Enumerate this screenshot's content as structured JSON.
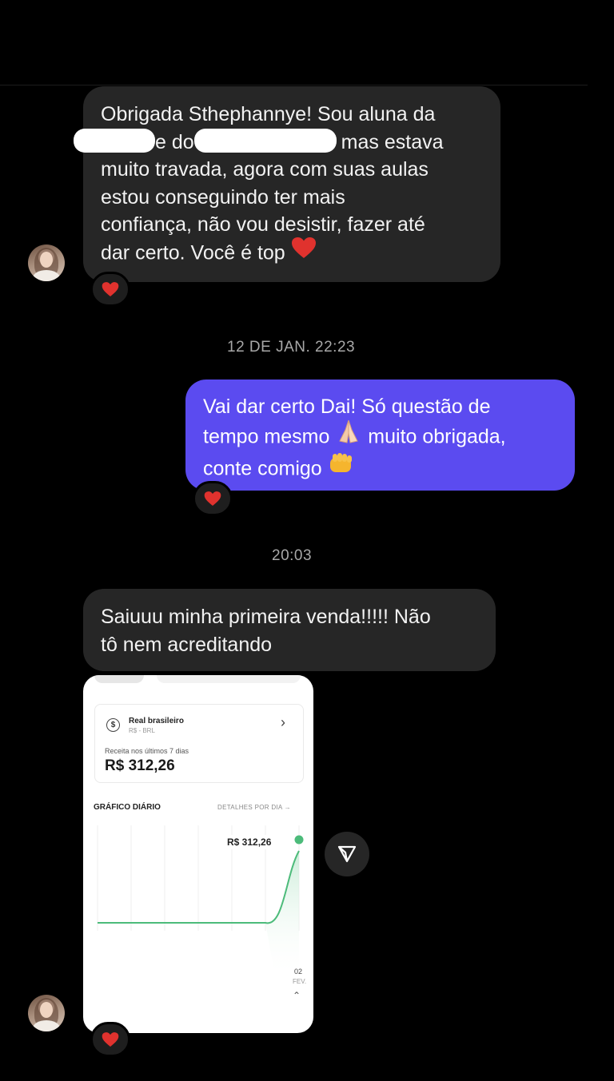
{
  "messages": {
    "msg1": {
      "line1": "Obrigada Sthephannye! Sou aluna da",
      "line2_mid": "e do",
      "line2_end": "mas estava",
      "line3": "muito travada, agora com suas aulas",
      "line4": "estou conseguindo ter mais",
      "line5": "confiança, não vou desistir, fazer até",
      "line6": "dar certo. Você é top"
    },
    "timestamp1": "12 DE JAN. 22:23",
    "msg2": {
      "line1": "Vai dar certo Dai! Só questão de",
      "line2a": "tempo mesmo",
      "line2b": "muito obrigada,",
      "line3": "conte comigo"
    },
    "timestamp2": "20:03",
    "msg3": {
      "line1": "Saiuuu minha primeira venda!!!!! Não",
      "line2": "tô nem acreditando"
    }
  },
  "screenshot_card": {
    "currency_symbol": "$",
    "currency_name": "Real brasileiro",
    "currency_code": "R$ - BRL",
    "revenue_label": "Receita nos últimos 7 dias",
    "revenue_value": "R$ 312,26",
    "chart_title": "GRÁFICO DIÁRIO",
    "details_link": "DETALHES POR DIA →",
    "point_label": "R$ 312,26",
    "x_day": "02",
    "x_month": "FEV."
  },
  "chart_data": {
    "type": "area",
    "title": "GRÁFICO DIÁRIO",
    "x": [
      "",
      "",
      "",
      "",
      "",
      "",
      "02 FEV."
    ],
    "series": [
      {
        "values": [
          0,
          0,
          0,
          0,
          0,
          0,
          312.26
        ]
      }
    ],
    "annotations": [
      "R$ 312,26"
    ],
    "grid": true,
    "color": "#4cbb7a"
  },
  "colors": {
    "incoming_bubble": "#262626",
    "outgoing_bubble": "#5b4bf0",
    "reaction_heart": "#e0322e"
  },
  "icons": [
    "heart-reaction-icon",
    "praying-hands-icon",
    "fist-icon",
    "share-send-icon",
    "avatar"
  ]
}
